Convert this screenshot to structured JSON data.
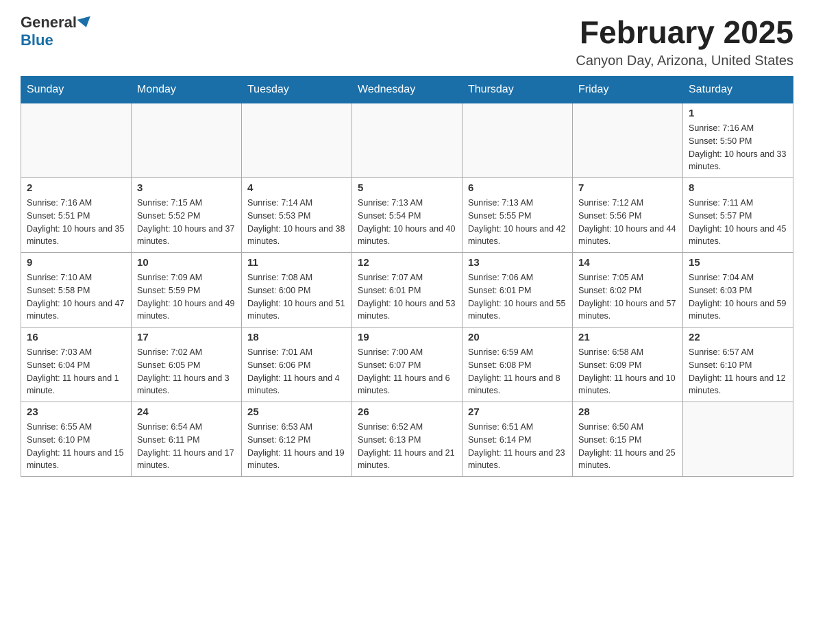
{
  "header": {
    "logo_general": "General",
    "logo_blue": "Blue",
    "month_title": "February 2025",
    "location": "Canyon Day, Arizona, United States"
  },
  "days_of_week": [
    "Sunday",
    "Monday",
    "Tuesday",
    "Wednesday",
    "Thursday",
    "Friday",
    "Saturday"
  ],
  "weeks": [
    [
      {
        "day": "",
        "info": ""
      },
      {
        "day": "",
        "info": ""
      },
      {
        "day": "",
        "info": ""
      },
      {
        "day": "",
        "info": ""
      },
      {
        "day": "",
        "info": ""
      },
      {
        "day": "",
        "info": ""
      },
      {
        "day": "1",
        "info": "Sunrise: 7:16 AM\nSunset: 5:50 PM\nDaylight: 10 hours and 33 minutes."
      }
    ],
    [
      {
        "day": "2",
        "info": "Sunrise: 7:16 AM\nSunset: 5:51 PM\nDaylight: 10 hours and 35 minutes."
      },
      {
        "day": "3",
        "info": "Sunrise: 7:15 AM\nSunset: 5:52 PM\nDaylight: 10 hours and 37 minutes."
      },
      {
        "day": "4",
        "info": "Sunrise: 7:14 AM\nSunset: 5:53 PM\nDaylight: 10 hours and 38 minutes."
      },
      {
        "day": "5",
        "info": "Sunrise: 7:13 AM\nSunset: 5:54 PM\nDaylight: 10 hours and 40 minutes."
      },
      {
        "day": "6",
        "info": "Sunrise: 7:13 AM\nSunset: 5:55 PM\nDaylight: 10 hours and 42 minutes."
      },
      {
        "day": "7",
        "info": "Sunrise: 7:12 AM\nSunset: 5:56 PM\nDaylight: 10 hours and 44 minutes."
      },
      {
        "day": "8",
        "info": "Sunrise: 7:11 AM\nSunset: 5:57 PM\nDaylight: 10 hours and 45 minutes."
      }
    ],
    [
      {
        "day": "9",
        "info": "Sunrise: 7:10 AM\nSunset: 5:58 PM\nDaylight: 10 hours and 47 minutes."
      },
      {
        "day": "10",
        "info": "Sunrise: 7:09 AM\nSunset: 5:59 PM\nDaylight: 10 hours and 49 minutes."
      },
      {
        "day": "11",
        "info": "Sunrise: 7:08 AM\nSunset: 6:00 PM\nDaylight: 10 hours and 51 minutes."
      },
      {
        "day": "12",
        "info": "Sunrise: 7:07 AM\nSunset: 6:01 PM\nDaylight: 10 hours and 53 minutes."
      },
      {
        "day": "13",
        "info": "Sunrise: 7:06 AM\nSunset: 6:01 PM\nDaylight: 10 hours and 55 minutes."
      },
      {
        "day": "14",
        "info": "Sunrise: 7:05 AM\nSunset: 6:02 PM\nDaylight: 10 hours and 57 minutes."
      },
      {
        "day": "15",
        "info": "Sunrise: 7:04 AM\nSunset: 6:03 PM\nDaylight: 10 hours and 59 minutes."
      }
    ],
    [
      {
        "day": "16",
        "info": "Sunrise: 7:03 AM\nSunset: 6:04 PM\nDaylight: 11 hours and 1 minute."
      },
      {
        "day": "17",
        "info": "Sunrise: 7:02 AM\nSunset: 6:05 PM\nDaylight: 11 hours and 3 minutes."
      },
      {
        "day": "18",
        "info": "Sunrise: 7:01 AM\nSunset: 6:06 PM\nDaylight: 11 hours and 4 minutes."
      },
      {
        "day": "19",
        "info": "Sunrise: 7:00 AM\nSunset: 6:07 PM\nDaylight: 11 hours and 6 minutes."
      },
      {
        "day": "20",
        "info": "Sunrise: 6:59 AM\nSunset: 6:08 PM\nDaylight: 11 hours and 8 minutes."
      },
      {
        "day": "21",
        "info": "Sunrise: 6:58 AM\nSunset: 6:09 PM\nDaylight: 11 hours and 10 minutes."
      },
      {
        "day": "22",
        "info": "Sunrise: 6:57 AM\nSunset: 6:10 PM\nDaylight: 11 hours and 12 minutes."
      }
    ],
    [
      {
        "day": "23",
        "info": "Sunrise: 6:55 AM\nSunset: 6:10 PM\nDaylight: 11 hours and 15 minutes."
      },
      {
        "day": "24",
        "info": "Sunrise: 6:54 AM\nSunset: 6:11 PM\nDaylight: 11 hours and 17 minutes."
      },
      {
        "day": "25",
        "info": "Sunrise: 6:53 AM\nSunset: 6:12 PM\nDaylight: 11 hours and 19 minutes."
      },
      {
        "day": "26",
        "info": "Sunrise: 6:52 AM\nSunset: 6:13 PM\nDaylight: 11 hours and 21 minutes."
      },
      {
        "day": "27",
        "info": "Sunrise: 6:51 AM\nSunset: 6:14 PM\nDaylight: 11 hours and 23 minutes."
      },
      {
        "day": "28",
        "info": "Sunrise: 6:50 AM\nSunset: 6:15 PM\nDaylight: 11 hours and 25 minutes."
      },
      {
        "day": "",
        "info": ""
      }
    ]
  ]
}
